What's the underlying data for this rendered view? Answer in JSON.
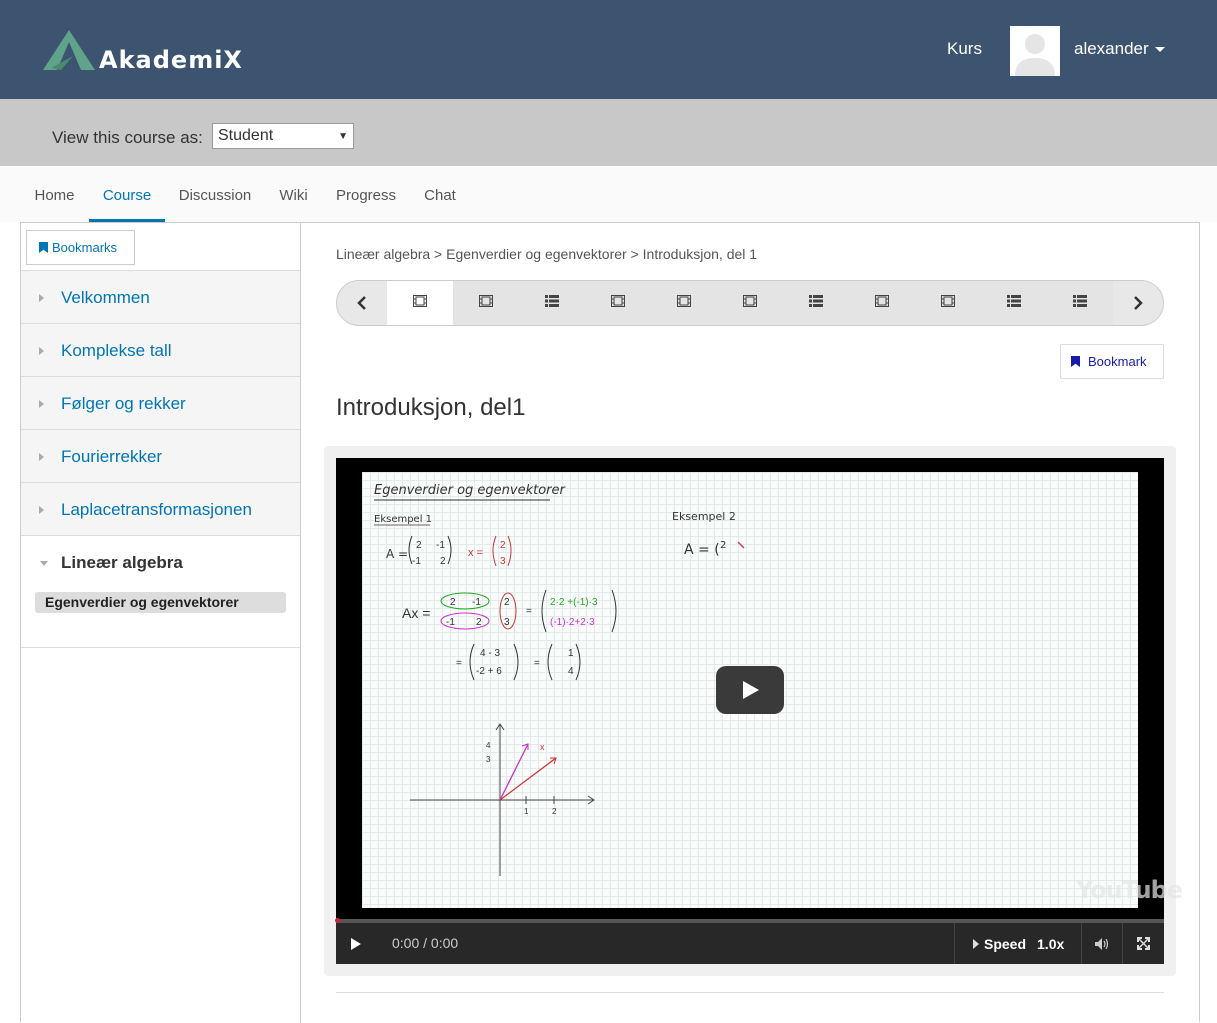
{
  "header": {
    "logo_text": "AkademiX",
    "nav_kurs": "Kurs",
    "username": "alexander",
    "bg_color": "#3d5470"
  },
  "staff_bar": {
    "view_as_label": "View this course as:",
    "view_as_value": "Student"
  },
  "tabs": [
    {
      "label": "Home"
    },
    {
      "label": "Course",
      "active": true
    },
    {
      "label": "Discussion"
    },
    {
      "label": "Wiki"
    },
    {
      "label": "Progress"
    },
    {
      "label": "Chat"
    }
  ],
  "sidebar": {
    "bookmarks_label": "Bookmarks",
    "chapters": [
      {
        "label": "Velkommen"
      },
      {
        "label": "Komplekse tall"
      },
      {
        "label": "Følger og rekker"
      },
      {
        "label": "Fourierrekker"
      },
      {
        "label": "Laplacetransformasjonen"
      }
    ],
    "open_chapter": {
      "label": "Lineær algebra",
      "subsection": "Egenverdier og egenvektorer"
    }
  },
  "content": {
    "breadcrumb": "Lineær algebra > Egenverdier og egenvektorer > Introduksjon, del 1",
    "sequence_items": [
      "video",
      "video",
      "list",
      "video",
      "video",
      "video",
      "list",
      "video",
      "video",
      "list",
      "list"
    ],
    "bookmark_label": "Bookmark",
    "unit_title": "Introduksjon, del1"
  },
  "video": {
    "whiteboard_title": "Egenverdier og egenvektorer",
    "example1": "Eksempel 1",
    "example2": "Eksempel 2",
    "time": "0:00 / 0:00",
    "speed_label": "Speed",
    "speed_value": "1.0x",
    "yt_logo": "YouTube"
  },
  "colors": {
    "accent": "#0075b4",
    "staff_bar": "#c8c8c8"
  }
}
